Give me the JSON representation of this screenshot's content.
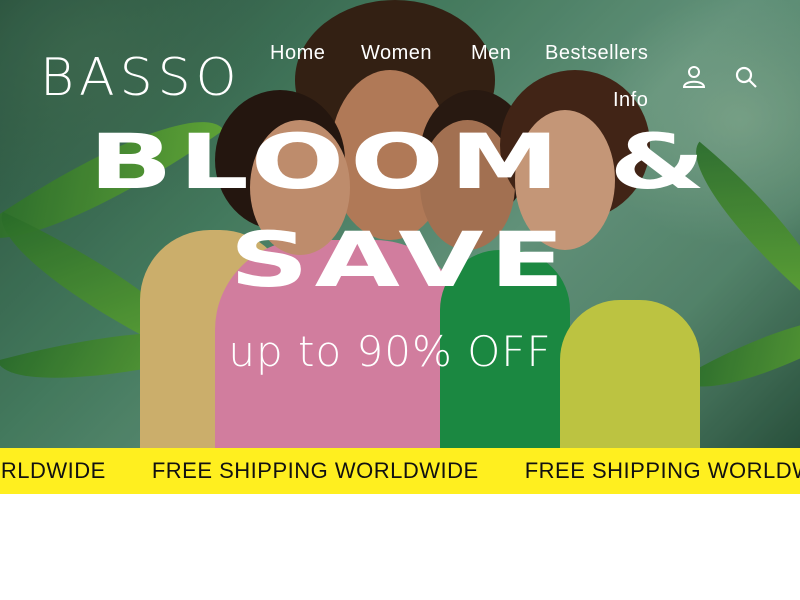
{
  "brand": {
    "logo": "BASSO"
  },
  "nav": {
    "items": [
      {
        "label": "Home"
      },
      {
        "label": "Women"
      },
      {
        "label": "Men"
      },
      {
        "label": "Bestsellers"
      },
      {
        "label": "Info"
      }
    ]
  },
  "header_icons": {
    "account": "account-icon",
    "search": "search-icon"
  },
  "hero": {
    "title_line1": "BLOOM &",
    "title_line2": "SAVE",
    "subtitle": "up to 90% OFF",
    "image": "four-models-in-colorful-outfits-among-palm-leaves"
  },
  "announcement": {
    "text_repeated": [
      "WORLDWIDE",
      "FREE SHIPPING WORLDWIDE",
      "FREE SHIPPING WORLDWIDE"
    ],
    "background": "#ffef1f"
  },
  "colors": {
    "accent_yellow": "#ffef1f",
    "header_text": "#ffffff"
  }
}
